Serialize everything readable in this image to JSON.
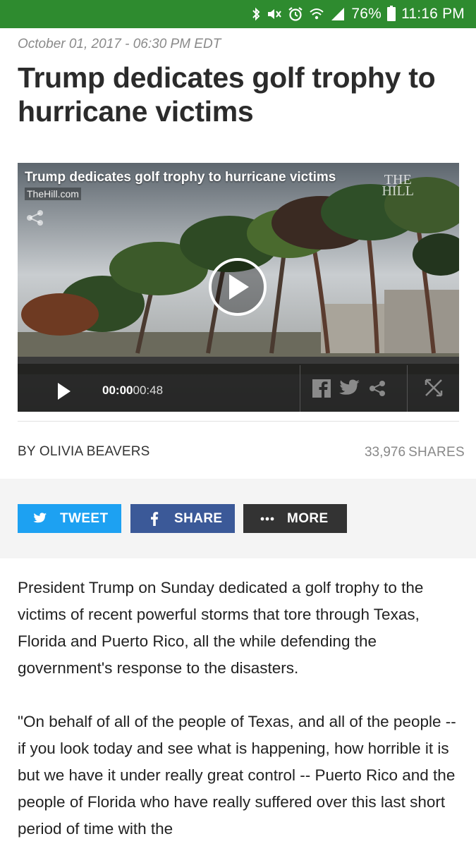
{
  "status_bar": {
    "battery": "76%",
    "time": "11:16 PM",
    "icons": [
      "bluetooth-icon",
      "mute-icon",
      "alarm-icon",
      "wifi-icon",
      "signal-icon",
      "battery-icon"
    ]
  },
  "article": {
    "dateline": "October 01, 2017 - 06:30 PM EDT",
    "headline": "Trump dedicates golf trophy to hurricane victims",
    "byline": "BY OLIVIA BEAVERS",
    "shares_count": "33,976",
    "shares_label": "SHARES",
    "paragraphs": [
      "President Trump on Sunday dedicated a golf trophy to the victims of recent powerful storms that tore through Texas, Florida and Puerto Rico, all the while defending the government's response to the disasters.",
      "\"On behalf of all of the people of Texas, and all of the people -- if you look today and see what is happening, how horrible it is but we have it under really great control -- Puerto Rico and the people of Florida who have really suffered over this last short period of time with the"
    ]
  },
  "video": {
    "title": "Trump dedicates golf trophy to hurricane victims",
    "source": "TheHill.com",
    "logo_line1": "THE",
    "logo_line2": "HILL",
    "current_time": "00:00",
    "duration": "00:48"
  },
  "share_buttons": {
    "tweet": "TWEET",
    "share": "SHARE",
    "more": "MORE"
  },
  "colors": {
    "status_bar": "#2e8b2f",
    "tweet": "#1da1f2",
    "share": "#3b5998",
    "more": "#333333"
  }
}
